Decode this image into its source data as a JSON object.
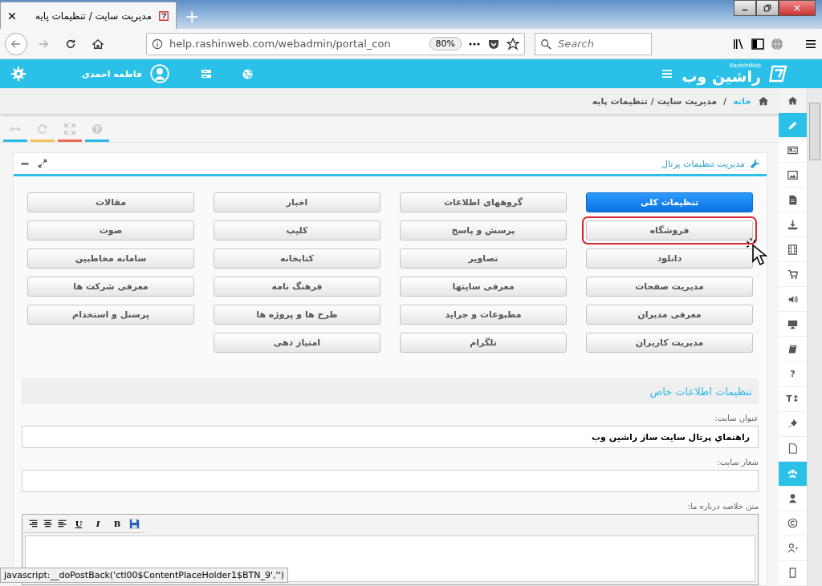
{
  "browser": {
    "tab_title": "مدیریت سایت / تنظیمات پایه",
    "new_tab": "+",
    "url": "help.rashinweb.com/webadmin/portal_con",
    "zoom": "80%",
    "search_placeholder": "Search"
  },
  "header": {
    "user_name": "فاطمه احمدی",
    "logo_latin": "RashinWeb",
    "logo": "راشین وب"
  },
  "breadcrumb": {
    "home": "خانه",
    "separator": "/",
    "current": "مدیریت سایت / تنظیمات پایه"
  },
  "toolbar": [
    {
      "color": "#2bbbe8"
    },
    {
      "color": "#f5c55a"
    },
    {
      "color": "#ef6a50"
    },
    {
      "color": "#2bbbe8"
    }
  ],
  "panel": {
    "title": "مدیریت تنظیمات پرتال",
    "buttons": [
      {
        "label": "تنظیمات کلی",
        "selected": true,
        "highlighted": false
      },
      {
        "label": "گروههای اطلاعات",
        "selected": false,
        "highlighted": false
      },
      {
        "label": "اخبار",
        "selected": false,
        "highlighted": false
      },
      {
        "label": "مقالات",
        "selected": false,
        "highlighted": false
      },
      {
        "label": "فروشگاه",
        "selected": false,
        "highlighted": true
      },
      {
        "label": "پرسش و پاسخ",
        "selected": false,
        "highlighted": false
      },
      {
        "label": "کلیپ",
        "selected": false,
        "highlighted": false
      },
      {
        "label": "صوت",
        "selected": false,
        "highlighted": false
      },
      {
        "label": "دانلود",
        "selected": false,
        "highlighted": false
      },
      {
        "label": "تصاویر",
        "selected": false,
        "highlighted": false
      },
      {
        "label": "کتابخانه",
        "selected": false,
        "highlighted": false
      },
      {
        "label": "سامانه مخاطبین",
        "selected": false,
        "highlighted": false
      },
      {
        "label": "مدیریت صفحات",
        "selected": false,
        "highlighted": false
      },
      {
        "label": "معرفی سایتها",
        "selected": false,
        "highlighted": false
      },
      {
        "label": "فرهنگ نامه",
        "selected": false,
        "highlighted": false
      },
      {
        "label": "معرفی شرکت ها",
        "selected": false,
        "highlighted": false
      },
      {
        "label": "معرفی مدیران",
        "selected": false,
        "highlighted": false
      },
      {
        "label": "مطبوعات و جراید",
        "selected": false,
        "highlighted": false
      },
      {
        "label": "طرح ها و پروژه ها",
        "selected": false,
        "highlighted": false
      },
      {
        "label": "پرسنل و استخدام",
        "selected": false,
        "highlighted": false
      },
      {
        "label": "مدیریت کاربران",
        "selected": false,
        "highlighted": false
      },
      {
        "label": "تلگرام",
        "selected": false,
        "highlighted": false
      },
      {
        "label": "امتیاز دهی",
        "selected": false,
        "highlighted": false
      }
    ],
    "section_title": "تنظیمات اطلاعات خاص",
    "fields": [
      {
        "label": "عنوان سایت:",
        "value": "راهنماي پرتال سايت ساز راشين وب"
      },
      {
        "label": "شعار سایت:"
      }
    ],
    "editor": {
      "label": "متن خلاصه درباره ما:",
      "tools": [
        {
          "kind": "save"
        },
        {
          "kind": "text",
          "text": "B"
        },
        {
          "kind": "text",
          "text": "I"
        },
        {
          "kind": "text",
          "text": "U"
        },
        {
          "kind": "align-left"
        },
        {
          "kind": "align-center"
        },
        {
          "kind": "align-right"
        }
      ]
    }
  },
  "sidebar": [
    {
      "kind": "icon",
      "selected": false
    },
    {
      "kind": "icon",
      "selected": true
    },
    {
      "kind": "icon",
      "selected": false
    },
    {
      "kind": "icon",
      "selected": false
    },
    {
      "kind": "icon",
      "selected": false
    },
    {
      "kind": "icon",
      "selected": false
    },
    {
      "kind": "icon",
      "selected": false
    },
    {
      "kind": "icon",
      "selected": false
    },
    {
      "kind": "icon",
      "selected": false
    },
    {
      "kind": "icon",
      "selected": false
    },
    {
      "kind": "icon",
      "selected": false
    },
    {
      "kind": "glyph",
      "glyph": "?",
      "selected": false
    },
    {
      "kind": "glyph",
      "glyph": "T↕",
      "selected": false
    },
    {
      "kind": "icon",
      "selected": false
    },
    {
      "kind": "icon",
      "selected": false
    },
    {
      "kind": "icon",
      "selected": true
    },
    {
      "kind": "icon",
      "selected": false
    },
    {
      "kind": "icon",
      "selected": false
    },
    {
      "kind": "icon",
      "selected": false
    },
    {
      "kind": "icon",
      "selected": false
    }
  ],
  "status_bar": "javascript:__doPostBack('ctl00$ContentPlaceHolder1$BTN_9','')"
}
